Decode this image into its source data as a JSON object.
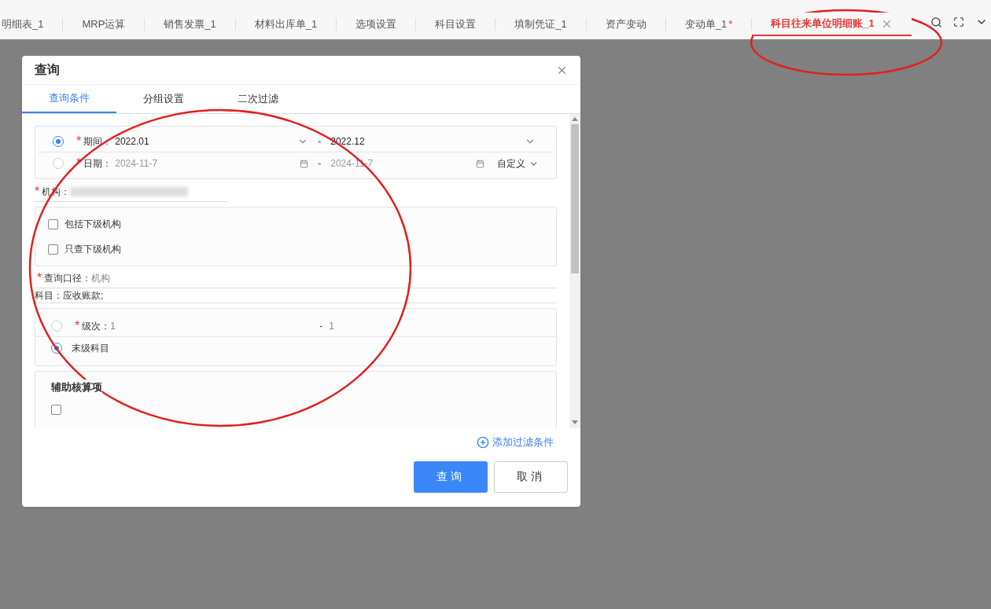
{
  "tabbar": {
    "tabs": [
      {
        "label": "明细表_1",
        "selected": false
      },
      {
        "label": "MRP运算",
        "selected": false
      },
      {
        "label": "销售发票_1",
        "selected": false
      },
      {
        "label": "材料出库单_1",
        "selected": false
      },
      {
        "label": "选项设置",
        "selected": false
      },
      {
        "label": "科目设置",
        "selected": false
      },
      {
        "label": "填制凭证_1",
        "selected": false
      },
      {
        "label": "资产变动",
        "selected": false
      },
      {
        "label": "变动单_1",
        "selected": false,
        "mark": "*"
      },
      {
        "label": "科目往来单位明细账_1",
        "selected": true,
        "closable": true
      }
    ]
  },
  "dialog": {
    "title": "查询",
    "tabs": [
      {
        "label": "查询条件",
        "selected": true
      },
      {
        "label": "分组设置",
        "selected": false
      },
      {
        "label": "二次过滤",
        "selected": false
      }
    ],
    "period_row": {
      "selected": true,
      "mark": "*",
      "label": "期间：",
      "from": "2022.01",
      "separator": "-",
      "to": "2022.12"
    },
    "date_row": {
      "selected": false,
      "mark": "*",
      "label": "日期：",
      "from": "2024-11-7",
      "separator": "-",
      "to": "2024-11-7",
      "mode": "自定义"
    },
    "org": {
      "mark": "*",
      "label": "机构："
    },
    "org_options": [
      {
        "label": "包括下级机构",
        "checked": false
      },
      {
        "label": "只查下级机构",
        "checked": false
      }
    ],
    "scope": {
      "mark": "*",
      "label": "查询口径：",
      "value": "机构"
    },
    "subject": {
      "label": "科目：",
      "value": "应收账款;"
    },
    "level_row": {
      "selected": false,
      "mark": "*",
      "label": "级次：",
      "from": "1",
      "separator": "-",
      "to": "1"
    },
    "leaf_row": {
      "selected": true,
      "label": "末级科目"
    },
    "aux": {
      "title": "辅助核算项",
      "items": [
        {
          "checked": false
        }
      ]
    },
    "add_filter": "添加过滤条件",
    "buttons": [
      {
        "label": "查询",
        "kind": "primary"
      },
      {
        "label": "取消",
        "kind": "default"
      }
    ]
  }
}
